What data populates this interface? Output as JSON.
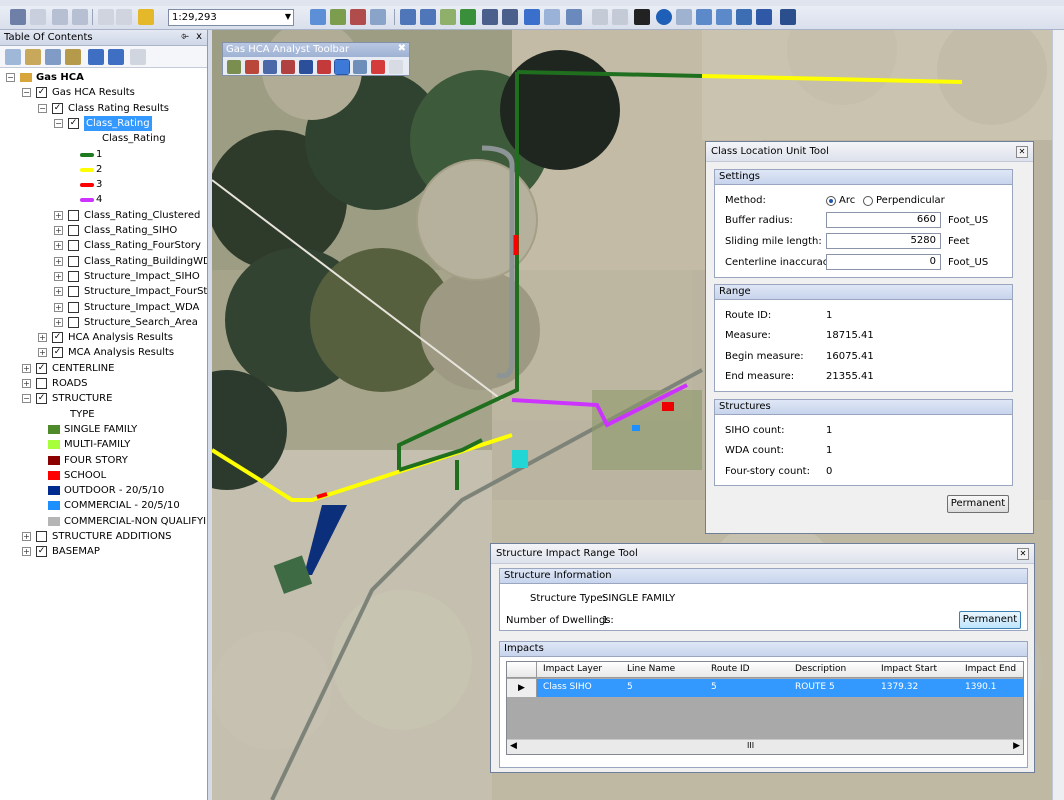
{
  "toolbar": {
    "scale": "1:29,293"
  },
  "toc": {
    "title": "Table Of Contents",
    "pin_glyph": "⌱",
    "close_glyph": "x",
    "tree": [
      {
        "label": "Gas HCA",
        "indent": 0,
        "expander": "-",
        "checkbox": null,
        "bold": true,
        "selected": false
      },
      {
        "label": "Gas HCA Results",
        "indent": 1,
        "expander": "-",
        "checkbox": "checked",
        "bold": false,
        "selected": false
      },
      {
        "label": "Class Rating Results",
        "indent": 2,
        "expander": "-",
        "checkbox": "checked",
        "bold": false,
        "selected": false
      },
      {
        "label": "Class_Rating",
        "indent": 3,
        "expander": "-",
        "checkbox": "checked",
        "bold": false,
        "selected": true
      },
      {
        "label": "Class_Rating",
        "indent": 4,
        "expander": null,
        "checkbox": null,
        "bold": false,
        "selected": false,
        "field": true
      },
      {
        "label": "1",
        "indent": 4,
        "legend_color": "#1f7a1f",
        "kind": "line"
      },
      {
        "label": "2",
        "indent": 4,
        "legend_color": "#ffff00",
        "kind": "line"
      },
      {
        "label": "3",
        "indent": 4,
        "legend_color": "#ff0000",
        "kind": "line"
      },
      {
        "label": "4",
        "indent": 4,
        "legend_color": "#cc33ff",
        "kind": "line"
      },
      {
        "label": "Class_Rating_Clustered",
        "indent": 3,
        "expander": "+",
        "checkbox": "unchecked"
      },
      {
        "label": "Class_Rating_SIHO",
        "indent": 3,
        "expander": "+",
        "checkbox": "unchecked"
      },
      {
        "label": "Class_Rating_FourStory",
        "indent": 3,
        "expander": "+",
        "checkbox": "unchecked"
      },
      {
        "label": "Class_Rating_BuildingWDA",
        "indent": 3,
        "expander": "+",
        "checkbox": "unchecked"
      },
      {
        "label": "Structure_Impact_SIHO",
        "indent": 3,
        "expander": "+",
        "checkbox": "unchecked"
      },
      {
        "label": "Structure_Impact_FourStory",
        "indent": 3,
        "expander": "+",
        "checkbox": "unchecked"
      },
      {
        "label": "Structure_Impact_WDA",
        "indent": 3,
        "expander": "+",
        "checkbox": "unchecked"
      },
      {
        "label": "Structure_Search_Area",
        "indent": 3,
        "expander": "+",
        "checkbox": "unchecked"
      },
      {
        "label": "HCA Analysis Results",
        "indent": 2,
        "expander": "+",
        "checkbox": "checked"
      },
      {
        "label": "MCA Analysis Results",
        "indent": 2,
        "expander": "+",
        "checkbox": "checked"
      },
      {
        "label": "CENTERLINE",
        "indent": 1,
        "expander": "+",
        "checkbox": "checked"
      },
      {
        "label": "ROADS",
        "indent": 1,
        "expander": "+",
        "checkbox": "unchecked"
      },
      {
        "label": "STRUCTURE",
        "indent": 1,
        "expander": "-",
        "checkbox": "checked"
      },
      {
        "label": "TYPE",
        "indent": 2,
        "field": true
      },
      {
        "label": "SINGLE FAMILY",
        "indent": 2,
        "legend_color": "#4f8a2a",
        "kind": "patch"
      },
      {
        "label": "MULTI-FAMILY",
        "indent": 2,
        "legend_color": "#a6ff3a",
        "kind": "patch"
      },
      {
        "label": "FOUR STORY",
        "indent": 2,
        "legend_color": "#8b0000",
        "kind": "patch"
      },
      {
        "label": "SCHOOL",
        "indent": 2,
        "legend_color": "#ff0000",
        "kind": "patch"
      },
      {
        "label": "OUTDOOR - 20/5/10",
        "indent": 2,
        "legend_color": "#002b8f",
        "kind": "patch"
      },
      {
        "label": "COMMERCIAL - 20/5/10",
        "indent": 2,
        "legend_color": "#1e8fff",
        "kind": "patch"
      },
      {
        "label": "COMMERCIAL-NON QUALIFYI",
        "indent": 2,
        "legend_color": "#b5b5b5",
        "kind": "patch"
      },
      {
        "label": "STRUCTURE ADDITIONS",
        "indent": 1,
        "expander": "+",
        "checkbox": "unchecked"
      },
      {
        "label": "BASEMAP",
        "indent": 1,
        "expander": "+",
        "checkbox": "checked"
      }
    ]
  },
  "analyst_toolbar": {
    "title": "Gas HCA Analyst Toolbar",
    "close_glyph": "✖"
  },
  "class_location_tool": {
    "title": "Class Location Unit Tool",
    "settings": {
      "header": "Settings",
      "method_label": "Method:",
      "method_options": [
        "Arc",
        "Perpendicular"
      ],
      "method_selected": "Arc",
      "buffer_radius_label": "Buffer radius:",
      "buffer_radius_value": "660",
      "buffer_radius_unit": "Foot_US",
      "sliding_mile_label": "Sliding mile length:",
      "sliding_mile_value": "5280",
      "sliding_mile_unit": "Feet",
      "centerline_label": "Centerline inaccuracy:",
      "centerline_value": "0",
      "centerline_unit": "Foot_US"
    },
    "range": {
      "header": "Range",
      "route_id_label": "Route ID:",
      "route_id_value": "1",
      "measure_label": "Measure:",
      "measure_value": "18715.41",
      "begin_label": "Begin measure:",
      "begin_value": "16075.41",
      "end_label": "End measure:",
      "end_value": "21355.41"
    },
    "structures": {
      "header": "Structures",
      "siho_label": "SIHO count:",
      "siho_value": "1",
      "wda_label": "WDA count:",
      "wda_value": "1",
      "four_story_label": "Four-story count:",
      "four_story_value": "0"
    },
    "permanent_label": "Permanent"
  },
  "structure_impact_tool": {
    "title": "Structure Impact Range Tool",
    "info_header": "Structure Information",
    "structure_type_label": "Structure Type:",
    "structure_type_value": "SINGLE FAMILY",
    "dwellings_label": "Number of Dwellings:",
    "dwellings_value": "1",
    "permanent_label": "Permanent",
    "impacts_header": "Impacts",
    "columns": [
      "Impact Layer",
      "Line Name",
      "Route ID",
      "Description",
      "Impact Start",
      "Impact End"
    ],
    "rows": [
      [
        "Class SIHO",
        "5",
        "5",
        "ROUTE 5",
        "1379.32",
        "1390.1"
      ]
    ],
    "row_marker": "▶",
    "scroll_grip": "III"
  }
}
